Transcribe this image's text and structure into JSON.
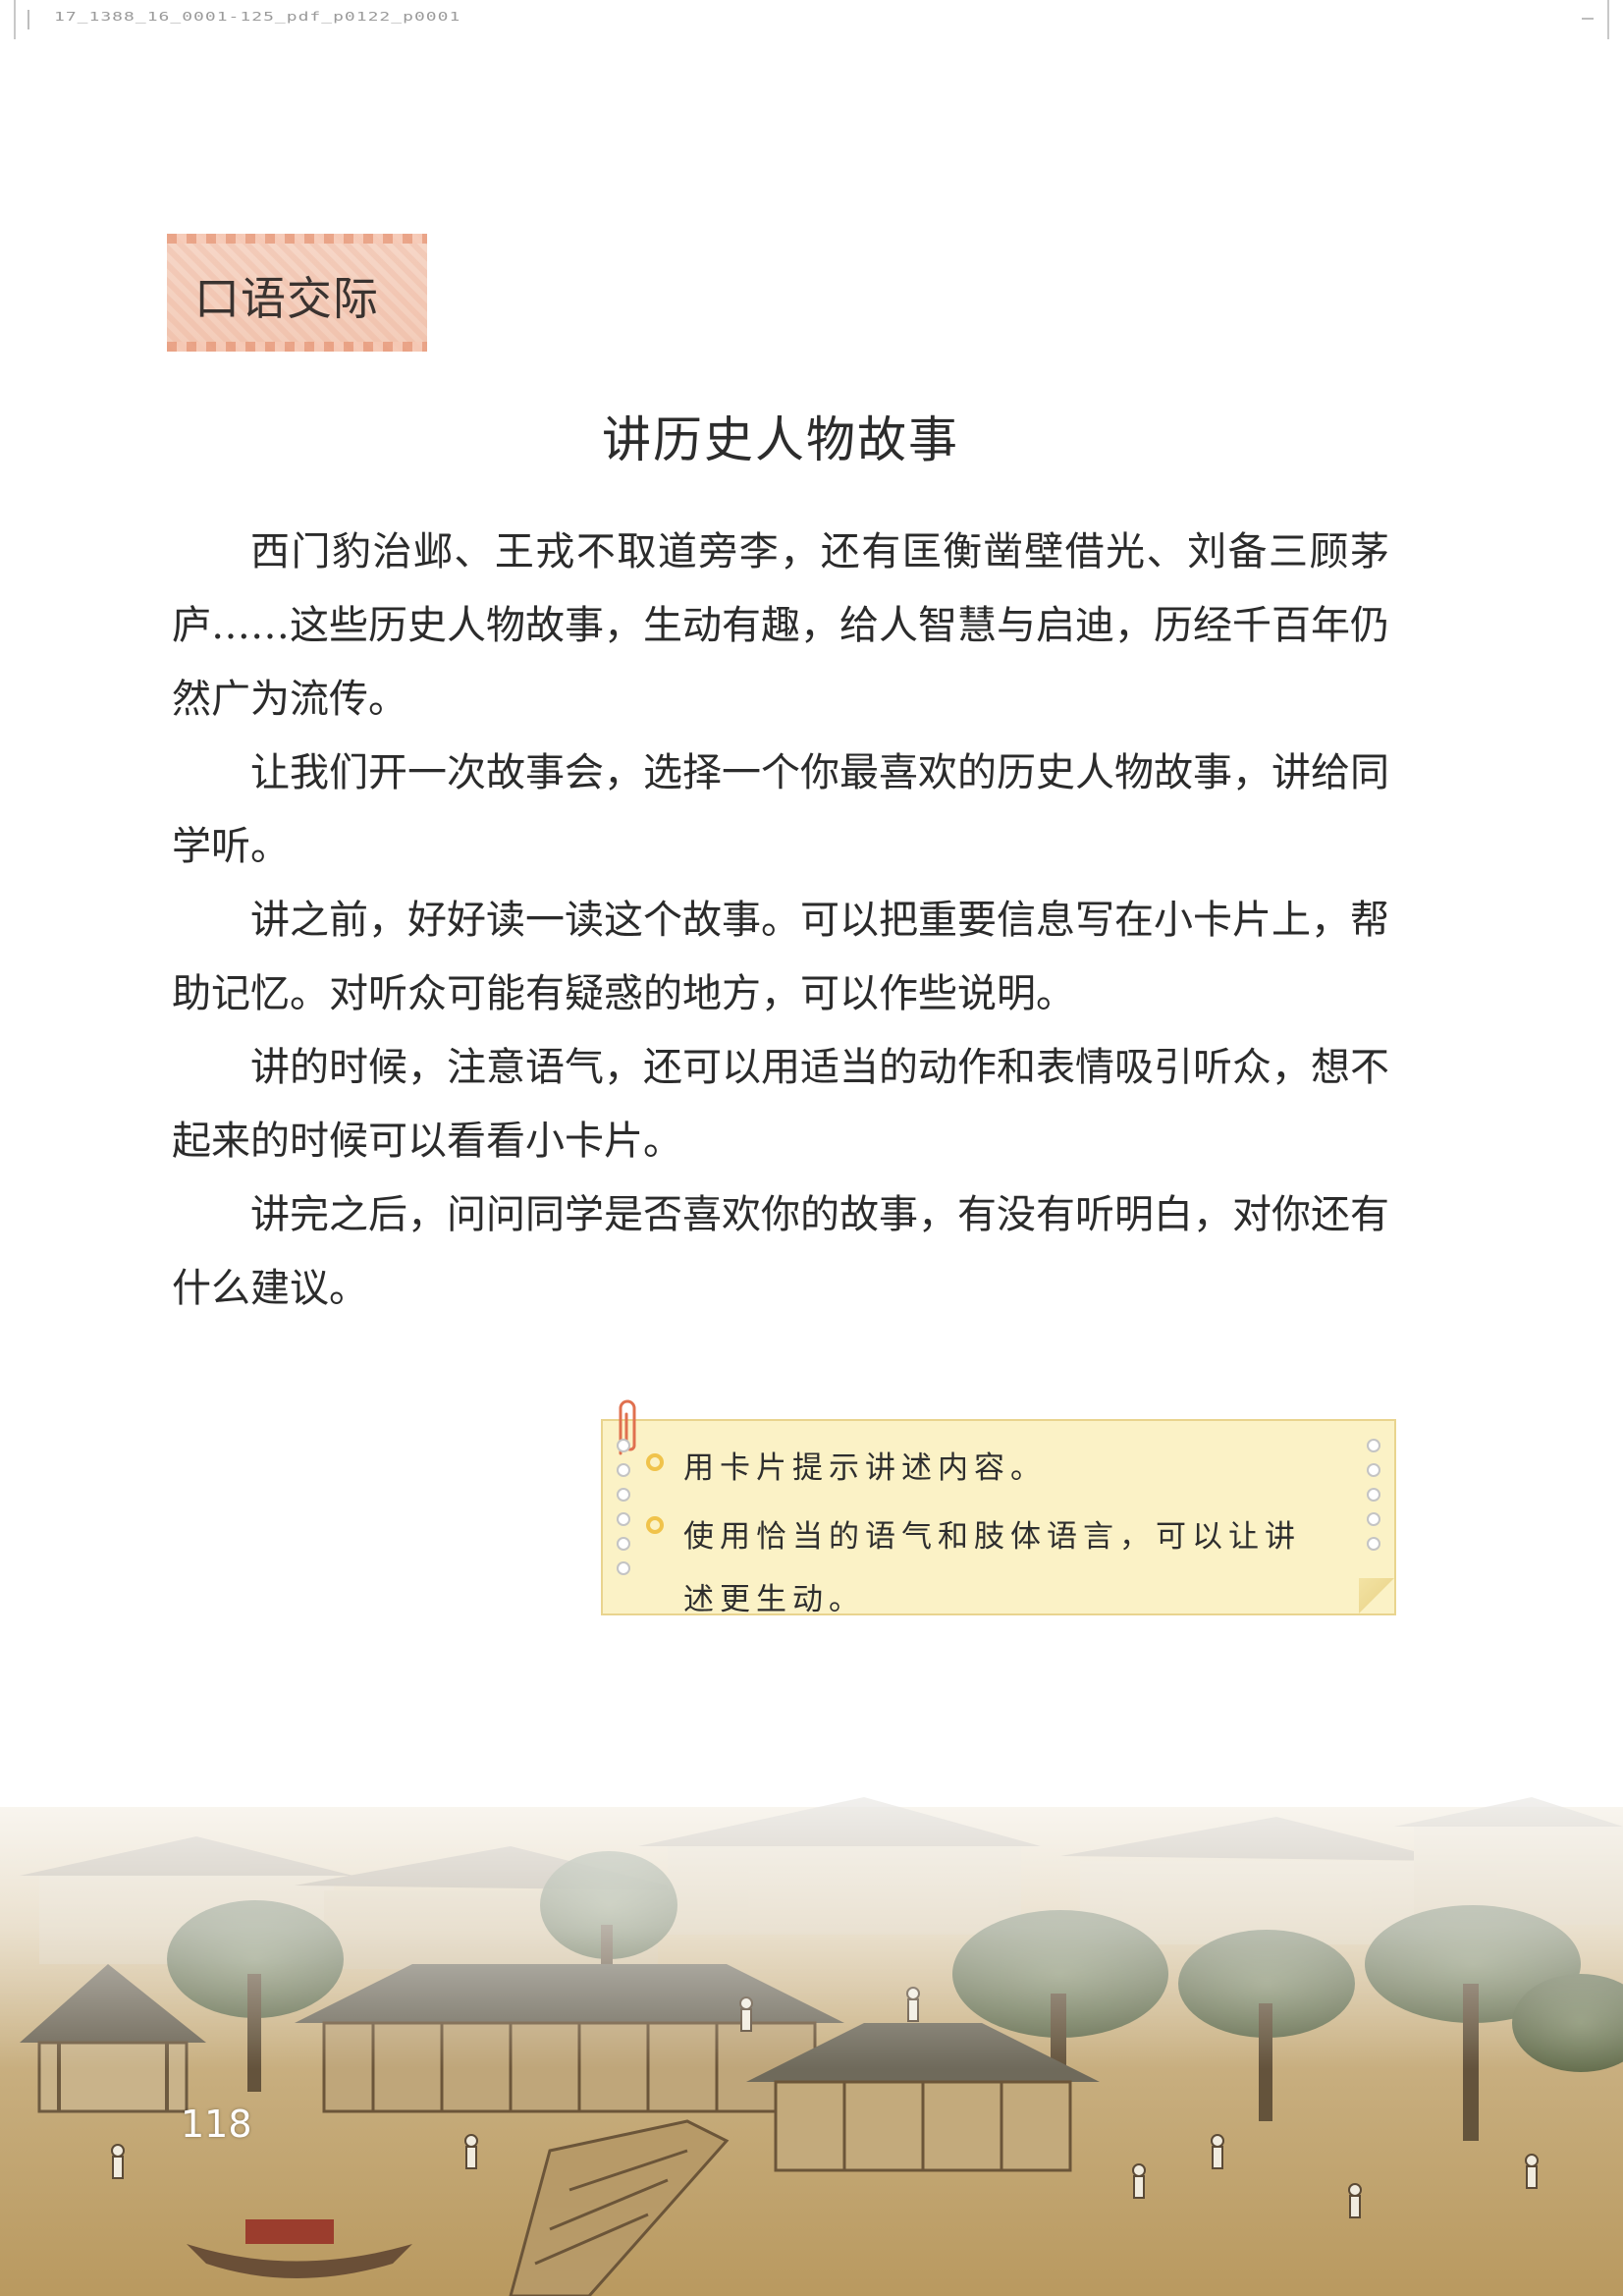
{
  "header": {
    "filename": "17_1388_16_0001-125_pdf_p0122_p0001"
  },
  "section_badge": "口语交际",
  "title": "讲历史人物故事",
  "paragraphs": [
    "西门豹治邺、王戎不取道旁李，还有匡衡凿壁借光、刘备三顾茅庐……这些历史人物故事，生动有趣，给人智慧与启迪，历经千百年仍然广为流传。",
    "让我们开一次故事会，选择一个你最喜欢的历史人物故事，讲给同学听。",
    "讲之前，好好读一读这个故事。可以把重要信息写在小卡片上，帮助记忆。对听众可能有疑惑的地方，可以作些说明。",
    "讲的时候，注意语气，还可以用适当的动作和表情吸引听众，想不起来的时候可以看看小卡片。",
    "讲完之后，问问同学是否喜欢你的故事，有没有听明白，对你还有什么建议。"
  ],
  "tips": [
    "用卡片提示讲述内容。",
    "使用恰当的语气和肢体语言，可以让讲述更生动。"
  ],
  "page_number": "118",
  "colors": {
    "badge_bg": "#f3ccb9",
    "tip_bg": "#fbf2c6",
    "tip_bullet": "#f0c34b",
    "painting_ground": "#c7a978"
  }
}
